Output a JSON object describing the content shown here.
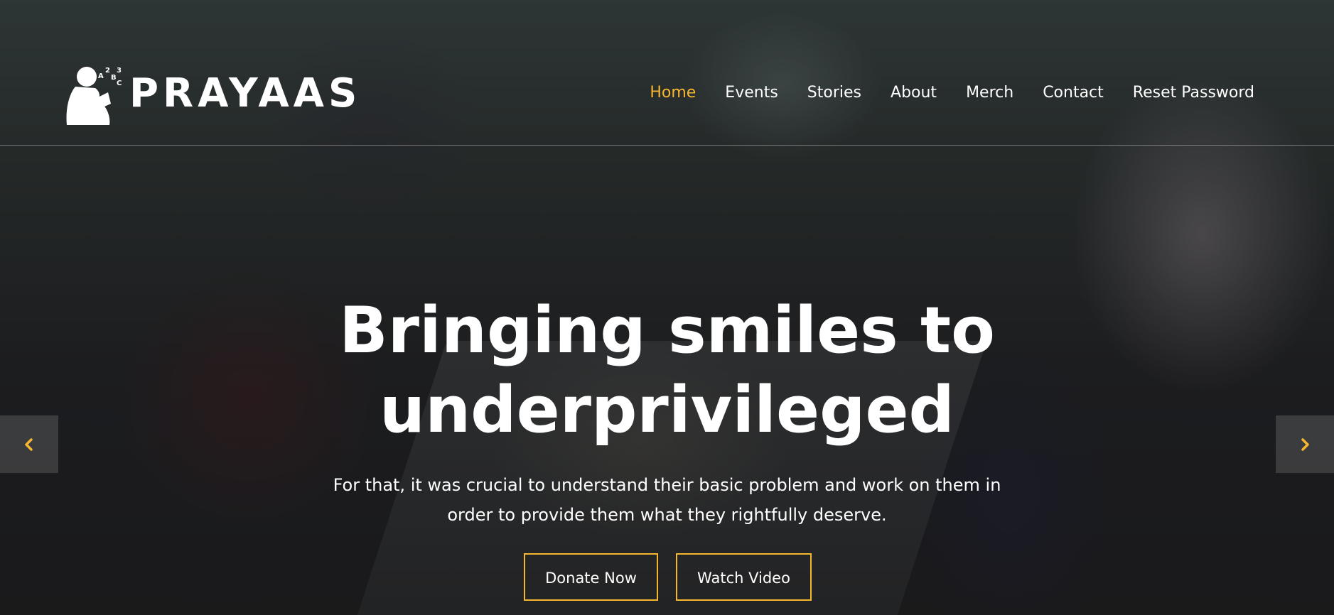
{
  "brand": {
    "name": "PRAYAAS",
    "logo_icon": "child-reading-with-letters-icon",
    "logo_glyphs": [
      "A",
      "2",
      "B",
      "3",
      "C"
    ]
  },
  "nav": {
    "items": [
      {
        "label": "Home",
        "active": true
      },
      {
        "label": "Events",
        "active": false
      },
      {
        "label": "Stories",
        "active": false
      },
      {
        "label": "About",
        "active": false
      },
      {
        "label": "Merch",
        "active": false
      },
      {
        "label": "Contact",
        "active": false
      },
      {
        "label": "Reset Password",
        "active": false
      }
    ]
  },
  "hero": {
    "title_line1": "Bringing smiles to",
    "title_line2": "underprivileged",
    "subtitle": "For that, it was crucial to understand their basic problem and work on them in order to provide them what they rightfully deserve.",
    "donate_label": "Donate Now",
    "video_label": "Watch Video"
  },
  "carousel": {
    "prev_icon": "chevron-left-icon",
    "next_icon": "chevron-right-icon"
  },
  "colors": {
    "accent": "#f5b731",
    "text": "#ffffff"
  }
}
